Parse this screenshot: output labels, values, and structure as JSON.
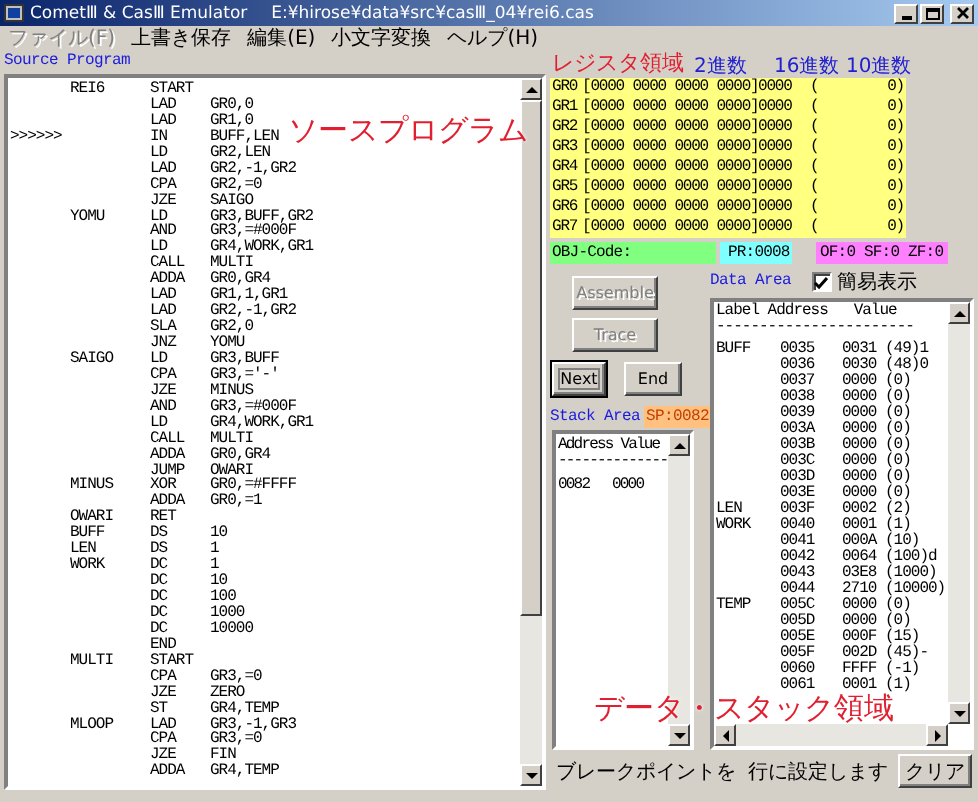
{
  "window": {
    "title": "CometⅢ & CasⅢ Emulator",
    "file_path": "E:¥hirose¥data¥src¥casⅢ_04¥rei6.cas"
  },
  "menu": [
    {
      "label": "ファイル(F)",
      "disabled": true
    },
    {
      "label": "上書き保存",
      "disabled": false
    },
    {
      "label": "編集(E)",
      "disabled": false
    },
    {
      "label": "小文字変換",
      "disabled": false
    },
    {
      "label": "ヘルプ(H)",
      "disabled": false
    }
  ],
  "source_program": {
    "title": "Source Program",
    "annotation": "ソースプログラム",
    "lines": [
      {
        "label": "REI6",
        "op": "START"
      },
      {
        "op": "LAD",
        "operand": "GR0,0"
      },
      {
        "op": "LAD",
        "operand": "GR1,0"
      },
      {
        "marker": ">>>>>>",
        "op": "IN",
        "operand": "BUFF,LEN"
      },
      {
        "op": "LD",
        "operand": "GR2,LEN"
      },
      {
        "op": "LAD",
        "operand": "GR2,-1,GR2"
      },
      {
        "op": "CPA",
        "operand": "GR2,=0"
      },
      {
        "op": "JZE",
        "operand": "SAIGO"
      },
      {
        "label": "YOMU",
        "op": "LD",
        "operand": "GR3,BUFF,GR2"
      },
      {
        "op": "AND",
        "operand": "GR3,=#000F"
      },
      {
        "op": "LD",
        "operand": "GR4,WORK,GR1"
      },
      {
        "op": "CALL",
        "operand": "MULTI"
      },
      {
        "op": "ADDA",
        "operand": "GR0,GR4"
      },
      {
        "op": "LAD",
        "operand": "GR1,1,GR1"
      },
      {
        "op": "LAD",
        "operand": "GR2,-1,GR2"
      },
      {
        "op": "SLA",
        "operand": "GR2,0"
      },
      {
        "op": "JNZ",
        "operand": "YOMU"
      },
      {
        "label": "SAIGO",
        "op": "LD",
        "operand": "GR3,BUFF"
      },
      {
        "op": "CPA",
        "operand": "GR3,='-'"
      },
      {
        "op": "JZE",
        "operand": "MINUS"
      },
      {
        "op": "AND",
        "operand": "GR3,=#000F"
      },
      {
        "op": "LD",
        "operand": "GR4,WORK,GR1"
      },
      {
        "op": "CALL",
        "operand": "MULTI"
      },
      {
        "op": "ADDA",
        "operand": "GR0,GR4"
      },
      {
        "op": "JUMP",
        "operand": "OWARI"
      },
      {
        "label": "MINUS",
        "op": "XOR",
        "operand": "GR0,=#FFFF"
      },
      {
        "op": "ADDA",
        "operand": "GR0,=1"
      },
      {
        "label": "OWARI",
        "op": "RET"
      },
      {
        "label": "BUFF",
        "op": "DS",
        "operand": "10"
      },
      {
        "label": "LEN",
        "op": "DS",
        "operand": "1"
      },
      {
        "label": "WORK",
        "op": "DC",
        "operand": "1"
      },
      {
        "op": "DC",
        "operand": "10"
      },
      {
        "op": "DC",
        "operand": "100"
      },
      {
        "op": "DC",
        "operand": "1000"
      },
      {
        "op": "DC",
        "operand": "10000"
      },
      {
        "op": "END"
      },
      {
        "label": "MULTI",
        "op": "START"
      },
      {
        "op": "CPA",
        "operand": "GR3,=0"
      },
      {
        "op": "JZE",
        "operand": "ZERO"
      },
      {
        "op": "ST",
        "operand": "GR4,TEMP"
      },
      {
        "label": "MLOOP",
        "op": "LAD",
        "operand": "GR3,-1,GR3"
      },
      {
        "op": "CPA",
        "operand": "GR3,=0"
      },
      {
        "op": "JZE",
        "operand": "FIN"
      },
      {
        "op": "ADDA",
        "operand": "GR4,TEMP"
      }
    ]
  },
  "registers": {
    "headers": [
      "2進数",
      "16進数",
      "10進数"
    ],
    "annotation": "レジスタ領域",
    "rows": [
      {
        "name": "GR0",
        "binary": "[0000 0000 0000 0000]",
        "hex": "0000",
        "decimal": [
          "(",
          "0)"
        ]
      },
      {
        "name": "GR1",
        "binary": "[0000 0000 0000 0000]",
        "hex": "0000",
        "decimal": [
          "(",
          "0)"
        ]
      },
      {
        "name": "GR2",
        "binary": "[0000 0000 0000 0000]",
        "hex": "0000",
        "decimal": [
          "(",
          "0)"
        ]
      },
      {
        "name": "GR3",
        "binary": "[0000 0000 0000 0000]",
        "hex": "0000",
        "decimal": [
          "(",
          "0)"
        ]
      },
      {
        "name": "GR4",
        "binary": "[0000 0000 0000 0000]",
        "hex": "0000",
        "decimal": [
          "(",
          "0)"
        ]
      },
      {
        "name": "GR5",
        "binary": "[0000 0000 0000 0000]",
        "hex": "0000",
        "decimal": [
          "(",
          "0)"
        ]
      },
      {
        "name": "GR6",
        "binary": "[0000 0000 0000 0000]",
        "hex": "0000",
        "decimal": [
          "(",
          "0)"
        ]
      },
      {
        "name": "GR7",
        "binary": "[0000 0000 0000 0000]",
        "hex": "0000",
        "decimal": [
          "(",
          "0)"
        ]
      }
    ]
  },
  "status": [
    {
      "text": "OBJ-Code:",
      "color": "#80ff80"
    },
    {
      "text": "PR:0008",
      "color": "#80ffff"
    },
    {
      "text": "OF:0 SF:0 ZF:0",
      "color": "#ff80ff"
    }
  ],
  "buttons": [
    {
      "label": "Assemble",
      "disabled": true,
      "focused": false
    },
    {
      "label": "Trace",
      "disabled": true,
      "focused": false
    },
    {
      "label": "Next",
      "disabled": false,
      "focused": true
    },
    {
      "label": "End",
      "disabled": false,
      "focused": false
    }
  ],
  "stack_area": {
    "title": "Stack Area",
    "sp": "SP:0082",
    "header": "Address Value",
    "divider": "--------------",
    "rows": [
      {
        "address": "0082",
        "value": "0000"
      }
    ]
  },
  "data_area": {
    "title": "Data Area",
    "simple_view": {
      "label": "簡易表示",
      "checked": true
    },
    "header": "Label Address   Value",
    "divider": "-----------------------",
    "annotation": "データ・スタック領域",
    "rows": [
      {
        "label": "BUFF",
        "address": "0035",
        "value": "0031 (49)1"
      },
      {
        "address": "0036",
        "value": "0030 (48)0"
      },
      {
        "address": "0037",
        "value": "0000 (0)"
      },
      {
        "address": "0038",
        "value": "0000 (0)"
      },
      {
        "address": "0039",
        "value": "0000 (0)"
      },
      {
        "address": "003A",
        "value": "0000 (0)"
      },
      {
        "address": "003B",
        "value": "0000 (0)"
      },
      {
        "address": "003C",
        "value": "0000 (0)"
      },
      {
        "address": "003D",
        "value": "0000 (0)"
      },
      {
        "address": "003E",
        "value": "0000 (0)"
      },
      {
        "label": "LEN",
        "address": "003F",
        "value": "0002 (2)"
      },
      {
        "label": "WORK",
        "address": "0040",
        "value": "0001 (1)"
      },
      {
        "address": "0041",
        "value": "000A (10)"
      },
      {
        "address": "0042",
        "value": "0064 (100)d"
      },
      {
        "address": "0043",
        "value": "03E8 (1000)"
      },
      {
        "address": "0044",
        "value": "2710 (10000)"
      },
      {
        "label": "TEMP",
        "address": "005C",
        "value": "0000 (0)"
      },
      {
        "address": "005D",
        "value": "0000 (0)"
      },
      {
        "address": "005E",
        "value": "000F (15)"
      },
      {
        "address": "005F",
        "value": "002D (45)-"
      },
      {
        "address": "0060",
        "value": "FFFF (-1)"
      },
      {
        "address": "0061",
        "value": "0001 (1)"
      }
    ]
  },
  "breakpoint": {
    "before": "ブレークポイントを",
    "after": "行に設定します",
    "button": "クリア"
  }
}
